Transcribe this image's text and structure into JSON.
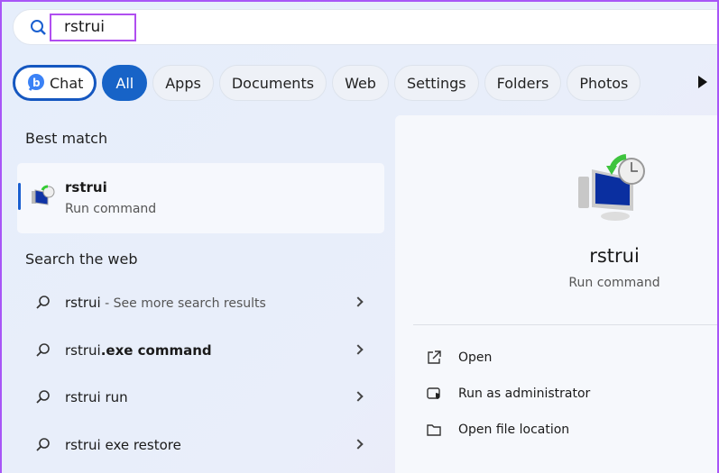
{
  "search": {
    "value": "rstrui"
  },
  "chips": [
    {
      "label": "Chat"
    },
    {
      "label": "All"
    },
    {
      "label": "Apps"
    },
    {
      "label": "Documents"
    },
    {
      "label": "Web"
    },
    {
      "label": "Settings"
    },
    {
      "label": "Folders"
    },
    {
      "label": "Photos"
    }
  ],
  "best_match": {
    "heading": "Best match",
    "title": "rstrui",
    "subtitle": "Run command"
  },
  "web": {
    "heading": "Search the web",
    "items": [
      {
        "label": "rstrui",
        "suffix": " - See more search results"
      },
      {
        "label": "rstrui.exe command",
        "bold": "rstrui",
        "rest": ".exe command"
      },
      {
        "label": "rstrui run"
      },
      {
        "label": "rstrui exe restore"
      }
    ]
  },
  "detail": {
    "title": "rstrui",
    "subtitle": "Run command",
    "actions": [
      {
        "label": "Open",
        "icon": "open-external-icon"
      },
      {
        "label": "Run as administrator",
        "icon": "shield-icon"
      },
      {
        "label": "Open file location",
        "icon": "folder-icon"
      }
    ]
  },
  "colors": {
    "accent": "#1763c7",
    "highlight": "#b04ef0"
  }
}
